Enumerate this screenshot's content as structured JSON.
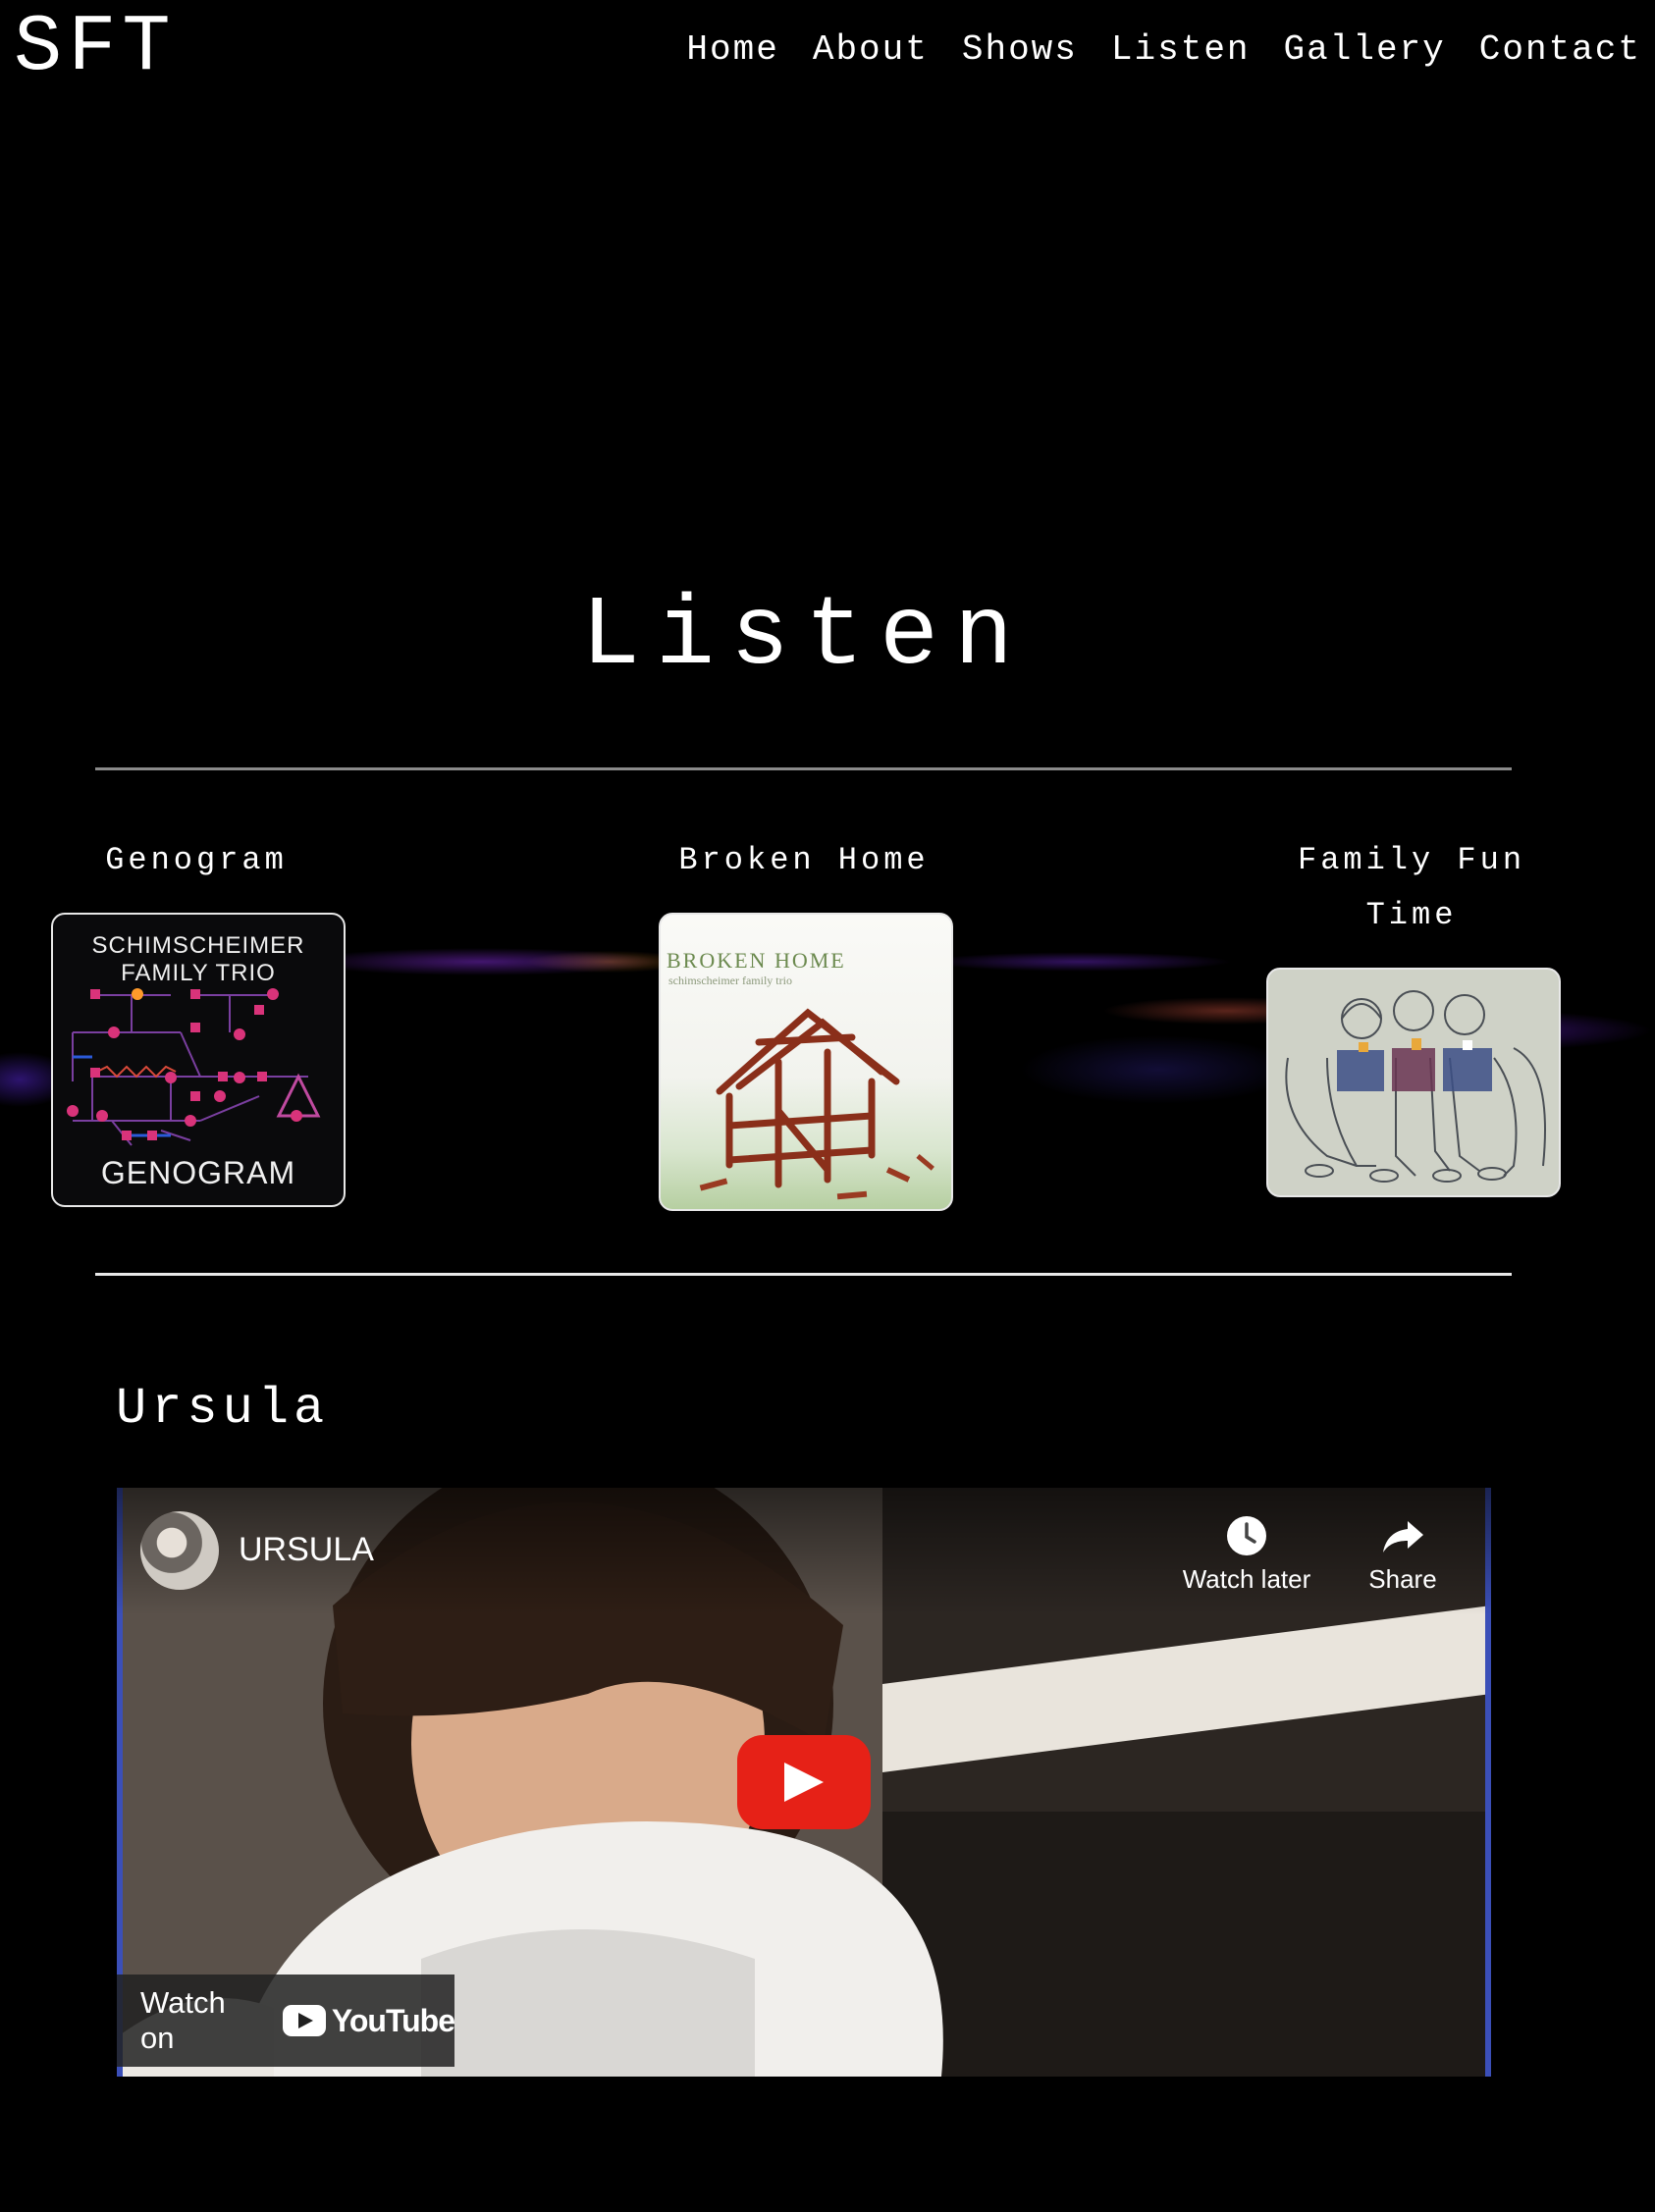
{
  "header": {
    "logo": "SFT",
    "nav": [
      "Home",
      "About",
      "Shows",
      "Listen",
      "Gallery",
      "Contact"
    ]
  },
  "page": {
    "title": "Listen"
  },
  "albums": [
    {
      "title": "Genogram",
      "cover_top_text": "SCHIMSCHEIMER FAMILY TRIO",
      "cover_bottom_text": "GENOGRAM"
    },
    {
      "title": "Broken Home",
      "cover_title": "BROKEN HOME",
      "cover_subtitle": "schimscheimer family trio"
    },
    {
      "title": "Family Fun Time"
    }
  ],
  "video_section": {
    "title": "Ursula",
    "video": {
      "title": "URSULA",
      "watch_later": "Watch later",
      "share": "Share",
      "watch_on": "Watch on",
      "platform": "YouTube"
    }
  },
  "colors": {
    "background": "#000000",
    "text": "#ffffff",
    "youtube_red": "#e62117"
  }
}
